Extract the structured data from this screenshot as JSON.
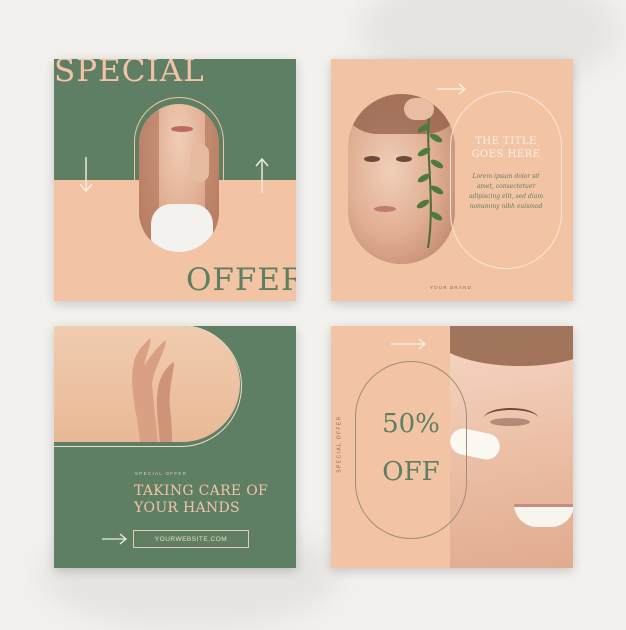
{
  "card1": {
    "title_top": "SPECIAL",
    "title_bottom": "OFFER",
    "colors": {
      "green": "#5e7f63",
      "peach": "#f2c4a4",
      "title": "#f2c4a4",
      "title_bottom": "#5e7f63"
    }
  },
  "card2": {
    "heading_line1": "THE TITLE",
    "heading_line2": "GOES HERE",
    "body_lines": [
      "Lorem ipsum dolor sit",
      "amet, consectetuer",
      "adipiscing elit, sed diam",
      "nonummy nibh euismod"
    ],
    "brand": "YOUR BRAND"
  },
  "card3": {
    "eyebrow": "SPECIAL OFFER",
    "headline_line1": "TAKING CARE OF",
    "headline_line2": "YOUR HANDS",
    "website": "YOURWEBSITE.COM"
  },
  "card4": {
    "vertical_text": "SPECIAL OFFER",
    "percent": "50%",
    "off": "OFF"
  },
  "icons": [
    "arrow-down-icon",
    "arrow-up-icon",
    "arrow-right-icon"
  ]
}
